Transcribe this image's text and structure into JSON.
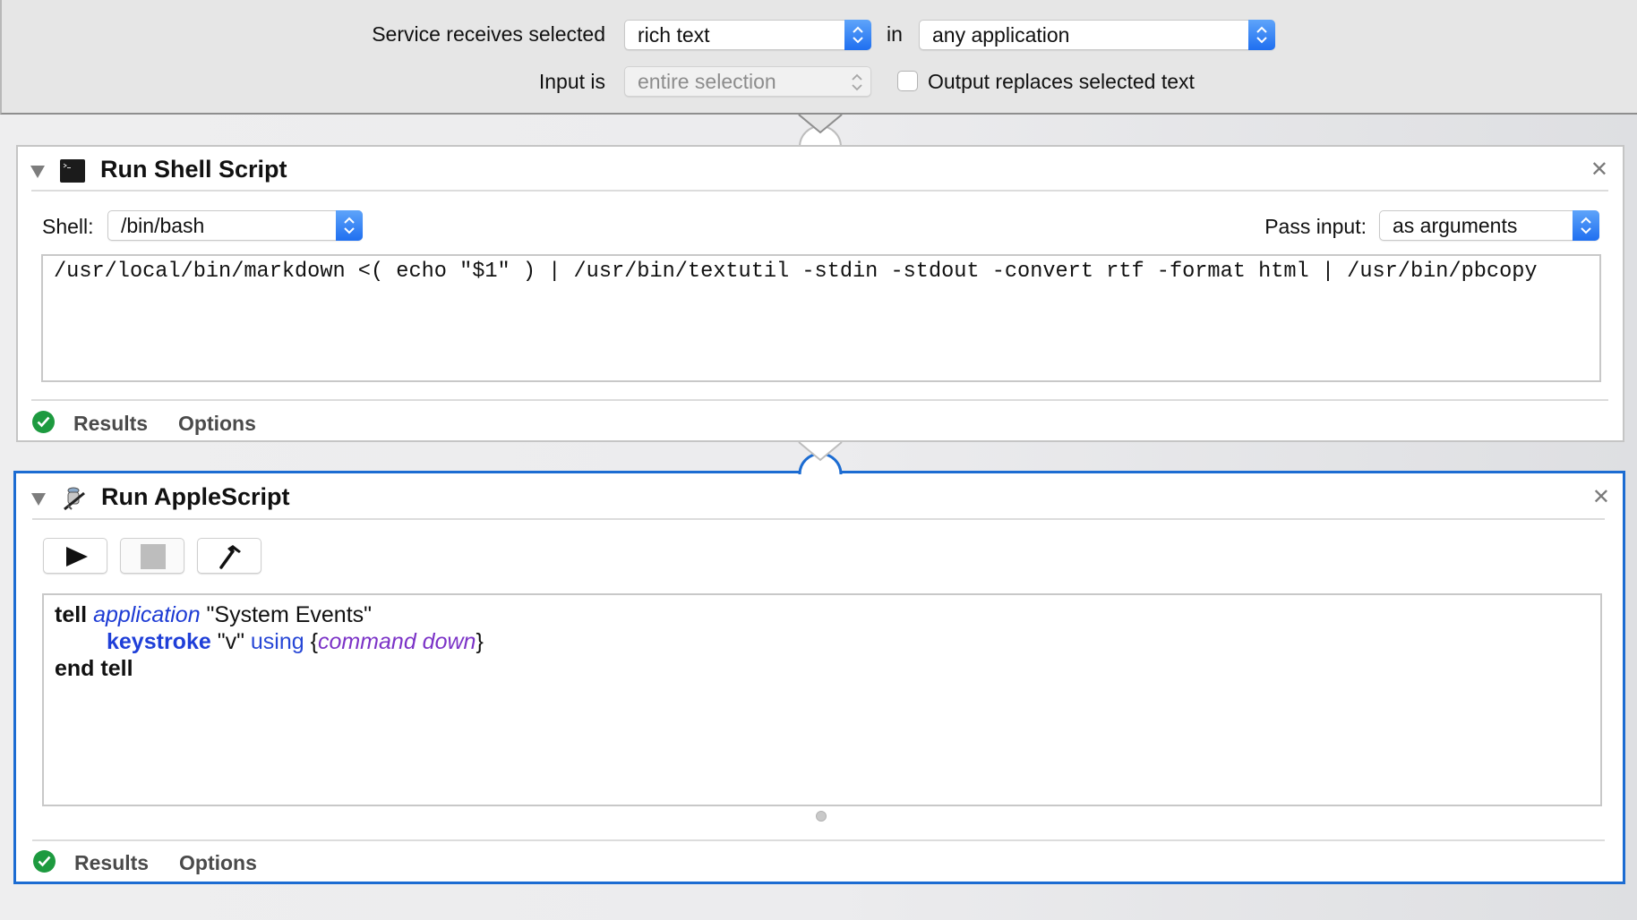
{
  "workflow_header": {
    "service_receives_label": "Service receives selected",
    "input_type_select": "rich text",
    "in_label": "in",
    "application_select": "any application",
    "input_is_label": "Input is",
    "input_is_select": "entire selection",
    "output_replaces_label": "Output replaces selected text",
    "output_replaces_checked": false
  },
  "actions": [
    {
      "title": "Run Shell Script",
      "icon": "terminal-icon",
      "shell_label": "Shell:",
      "shell_value": "/bin/bash",
      "pass_input_label": "Pass input:",
      "pass_input_value": "as arguments",
      "script": "/usr/local/bin/markdown <( echo \"$1\" ) | /usr/bin/textutil -stdin -stdout -convert rtf -format html | /usr/bin/pbcopy",
      "tabs": [
        "Results",
        "Options"
      ],
      "status": "success",
      "close_glyph": "✕"
    },
    {
      "title": "Run AppleScript",
      "icon": "applescript-icon",
      "selected": true,
      "toolbar": [
        {
          "name": "run",
          "icon": "play-icon"
        },
        {
          "name": "stop",
          "icon": "stop-icon",
          "disabled": true
        },
        {
          "name": "compile",
          "icon": "hammer-icon"
        }
      ],
      "script_lines": {
        "l1": {
          "kw": "tell",
          "cls": "application",
          "str": " \"System Events\""
        },
        "l2": {
          "cmd": "keystroke",
          "str": " \"v\" ",
          "param": "using",
          "open": " {",
          "enum": "command down",
          "close": "}"
        },
        "l3": {
          "kw": "end tell"
        }
      },
      "tabs": [
        "Results",
        "Options"
      ],
      "status": "success",
      "close_glyph": "✕"
    }
  ],
  "colors": {
    "selection_blue": "#1c6cd2",
    "stepper_blue": "#1f6ff0",
    "success_green": "#1d9a3f",
    "applescript_class": "#1d3bd4",
    "applescript_enum": "#7c33c7"
  }
}
